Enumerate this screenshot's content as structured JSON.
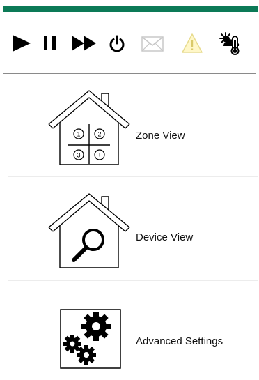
{
  "toolbar": {
    "icons": [
      "play-icon",
      "pause-icon",
      "fast-forward-icon",
      "power-icon",
      "mail-icon",
      "warning-icon",
      "weather-temperature-icon"
    ],
    "accent_color": "#0c7a57"
  },
  "menu": {
    "items": [
      {
        "label": "Zone View",
        "icon": "house-zones-icon"
      },
      {
        "label": "Device View",
        "icon": "house-magnifier-icon"
      },
      {
        "label": "Advanced Settings",
        "icon": "gears-icon"
      }
    ],
    "zones": [
      "1",
      "2",
      "3",
      "+"
    ]
  }
}
